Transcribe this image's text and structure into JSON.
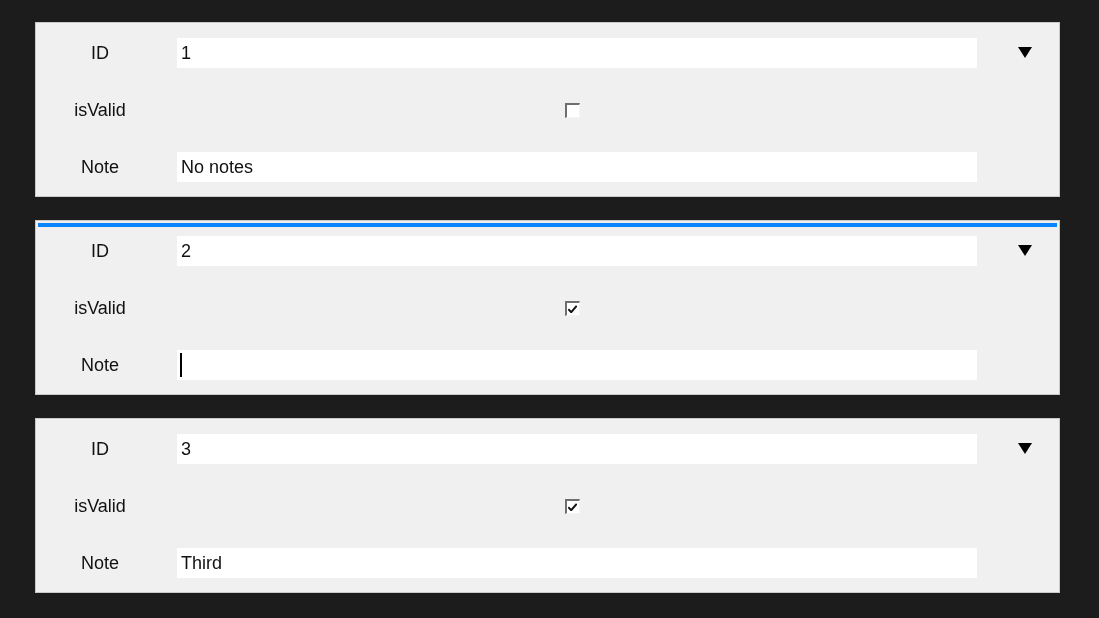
{
  "records": [
    {
      "selected": false,
      "fields": [
        {
          "kind": "text",
          "label": "ID",
          "value": "1",
          "focused": false
        },
        {
          "kind": "checkbox",
          "label": "isValid",
          "checked": false
        },
        {
          "kind": "text",
          "label": "Note",
          "value": "No notes",
          "focused": false
        }
      ]
    },
    {
      "selected": true,
      "fields": [
        {
          "kind": "text",
          "label": "ID",
          "value": "2",
          "focused": false
        },
        {
          "kind": "checkbox",
          "label": "isValid",
          "checked": true
        },
        {
          "kind": "text",
          "label": "Note",
          "focused": true
        }
      ]
    },
    {
      "selected": false,
      "fields": [
        {
          "kind": "text",
          "label": "ID",
          "value": "3",
          "focused": false
        },
        {
          "kind": "checkbox",
          "label": "isValid",
          "checked": true
        },
        {
          "kind": "text",
          "label": "Note",
          "value": "Third",
          "focused": false
        }
      ]
    }
  ]
}
